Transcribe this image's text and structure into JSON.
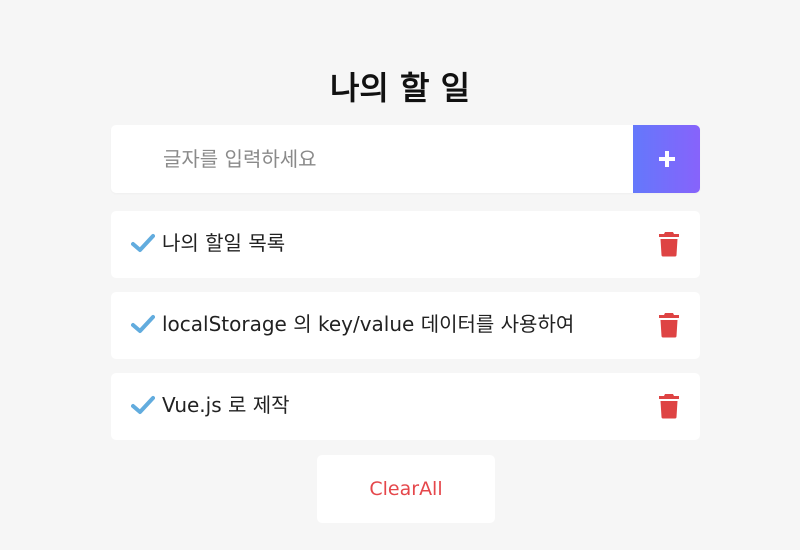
{
  "header": {
    "title": "나의 할 일"
  },
  "input": {
    "placeholder": "글자를 입력하세요",
    "value": ""
  },
  "add_button": {
    "icon": "plus-icon",
    "gradient": [
      "#6478fb",
      "#8763fb"
    ]
  },
  "todos": [
    {
      "text": "나의 할일 목록"
    },
    {
      "text": "localStorage 의 key/value 데이터를 사용하여"
    },
    {
      "text": "Vue.js 로 제작"
    }
  ],
  "footer": {
    "clear_label": "ClearAll"
  },
  "colors": {
    "background": "#f6f6f6",
    "check": "#62acde",
    "trash": "#de4343",
    "clear_text": "#e5474b"
  }
}
